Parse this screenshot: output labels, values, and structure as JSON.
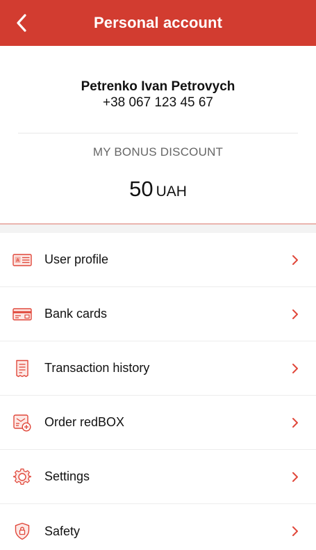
{
  "header": {
    "title": "Personal account",
    "back_icon": "chevron-left-icon",
    "background": "#d23c30"
  },
  "profile": {
    "name": "Petrenko Ivan Petrovych",
    "phone": "+38 067 123 45 67"
  },
  "bonus": {
    "label": "MY BONUS DISCOUNT",
    "amount": "50",
    "currency": "UAH"
  },
  "accent_color": "#e0473a",
  "menu": [
    {
      "label": "User profile",
      "icon": "id-card-icon"
    },
    {
      "label": "Bank cards",
      "icon": "bank-card-icon"
    },
    {
      "label": "Transaction history",
      "icon": "receipt-icon"
    },
    {
      "label": "Order redBOX",
      "icon": "redbox-order-icon"
    },
    {
      "label": "Settings",
      "icon": "gear-icon"
    },
    {
      "label": "Safety",
      "icon": "shield-lock-icon"
    }
  ]
}
